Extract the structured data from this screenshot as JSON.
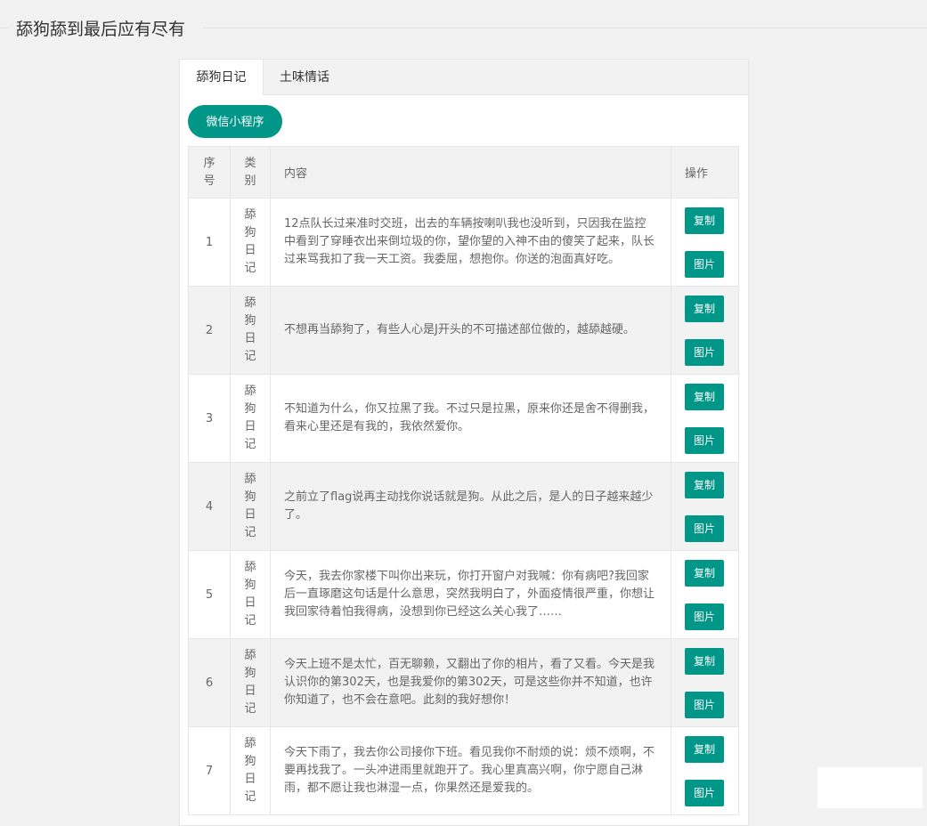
{
  "page": {
    "title": "舔狗舔到最后应有尽有"
  },
  "tabs": [
    {
      "label": "舔狗日记",
      "active": true
    },
    {
      "label": "土味情话",
      "active": false
    }
  ],
  "toolbar": {
    "miniprogram_label": "微信小程序"
  },
  "table": {
    "headers": {
      "index": [
        "序",
        "号"
      ],
      "category": [
        "类",
        "别"
      ],
      "content": "内容",
      "actions": "操作"
    },
    "action_labels": {
      "copy": "复制",
      "image": "图片"
    },
    "rows": [
      {
        "index": "1",
        "category": [
          "舔",
          "狗",
          "日",
          "记"
        ],
        "content": "12点队长过来准时交班，出去的车辆按喇叭我也没听到，只因我在监控中看到了穿睡衣出来倒垃圾的你，望你望的入神不由的傻笑了起来，队长过来骂我扣了我一天工资。我委屈，想抱你。你送的泡面真好吃。"
      },
      {
        "index": "2",
        "category": [
          "舔",
          "狗",
          "日",
          "记"
        ],
        "content": "不想再当舔狗了，有些人心是J开头的不可描述部位做的，越舔越硬。"
      },
      {
        "index": "3",
        "category": [
          "舔",
          "狗",
          "日",
          "记"
        ],
        "content": "不知道为什么，你又拉黑了我。不过只是拉黑，原来你还是舍不得删我，看来心里还是有我的，我依然爱你。"
      },
      {
        "index": "4",
        "category": [
          "舔",
          "狗",
          "日",
          "记"
        ],
        "content": "之前立了flag说再主动找你说话就是狗。从此之后，是人的日子越来越少了。"
      },
      {
        "index": "5",
        "category": [
          "舔",
          "狗",
          "日",
          "记"
        ],
        "content": "今天，我去你家楼下叫你出来玩，你打开窗户对我喊：你有病吧?我回家后一直琢磨这句话是什么意思，突然我明白了，外面疫情很严重，你想让我回家待着怕我得病，没想到你已经这么关心我了……"
      },
      {
        "index": "6",
        "category": [
          "舔",
          "狗",
          "日",
          "记"
        ],
        "content": "今天上班不是太忙，百无聊赖，又翻出了你的相片，看了又看。今天是我认识你的第302天，也是我爱你的第302天，可是这些你并不知道，也许你知道了，也不会在意吧。此刻的我好想你！"
      },
      {
        "index": "7",
        "category": [
          "舔",
          "狗",
          "日",
          "记"
        ],
        "content": "今天下雨了，我去你公司接你下班。看见我你不耐烦的说：烦不烦啊，不要再找我了。一头冲进雨里就跑开了。我心里真高兴啊，你宁愿自己淋雨，都不愿让我也淋湿一点，你果然还是爱我的。"
      }
    ]
  },
  "colors": {
    "accent": "#009688",
    "background": "#f2f2f2"
  }
}
